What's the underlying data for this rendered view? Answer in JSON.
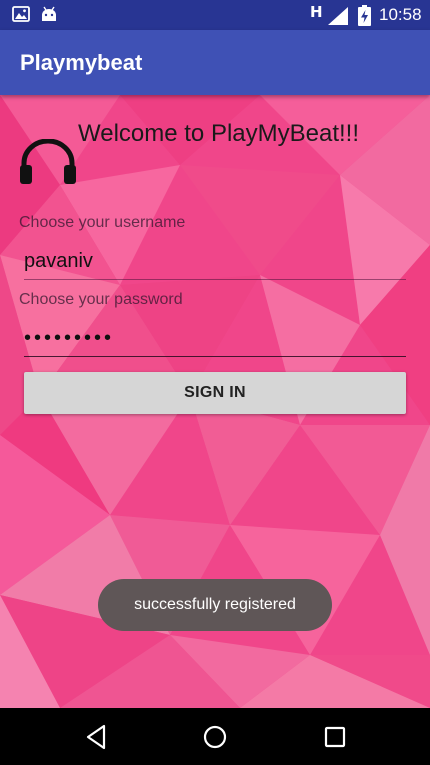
{
  "status_bar": {
    "network_type": "H",
    "time": "10:58",
    "icons": [
      "gallery-icon",
      "android-icon",
      "signal-icon",
      "battery-charging-icon"
    ]
  },
  "app_bar": {
    "title": "Playmybeat"
  },
  "login": {
    "welcome": "Welcome to PlayMyBeat!!!",
    "username_label": "Choose your username",
    "username_value": "pavaniv",
    "password_label": "Choose your password",
    "password_value": "pavaniv12",
    "signin_label": "SIGN IN"
  },
  "toast": {
    "message": "successfully registered"
  },
  "nav_bar": {
    "buttons": [
      "back-icon",
      "home-icon",
      "recents-icon"
    ]
  },
  "colors": {
    "status_bar": "#283593",
    "app_bar": "#3f51b5",
    "background": "#f0468a",
    "button": "#d6d6d6",
    "toast": "#5f5657",
    "nav_bar": "#000000"
  }
}
